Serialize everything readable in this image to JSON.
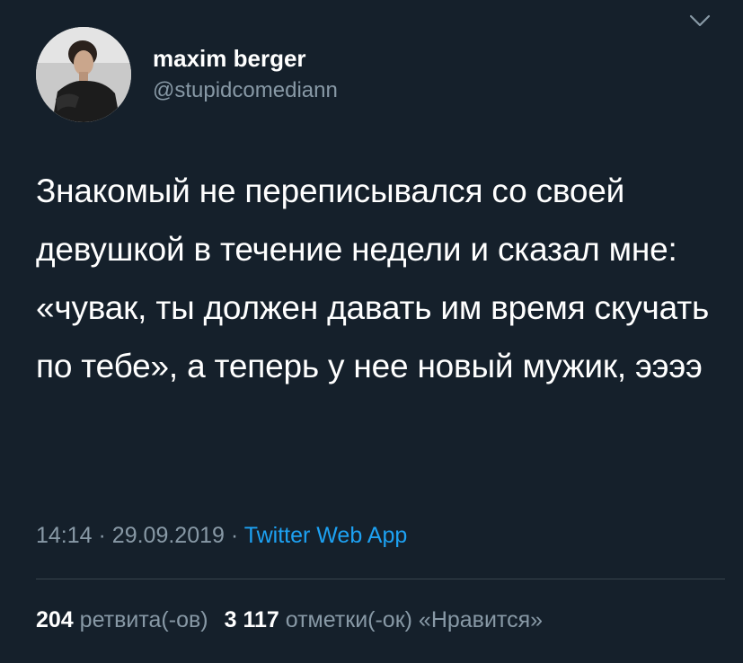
{
  "tweet": {
    "author": {
      "display_name": "maxim berger",
      "handle": "@stupidcomediann",
      "avatar_icon": "profile-photo"
    },
    "menu_icon": "chevron-down-icon",
    "text": "Знакомый не переписывался со своей девушкой в течение недели и сказал мне: «чувак, ты должен давать им время скучать по тебе», а теперь у нее новый мужик, ээээ",
    "time": "14:14",
    "separator": "·",
    "date": "29.09.2019",
    "source": "Twitter Web App",
    "stats": {
      "retweets_count": "204",
      "retweets_label": "ретвита(-ов)",
      "likes_count": "3 117",
      "likes_label": "отметки(-ок) «Нравится»"
    }
  },
  "colors": {
    "background": "#15202b",
    "text_primary": "#ffffff",
    "text_secondary": "#8899a6",
    "link": "#1da1f2",
    "divider": "#38444d"
  }
}
